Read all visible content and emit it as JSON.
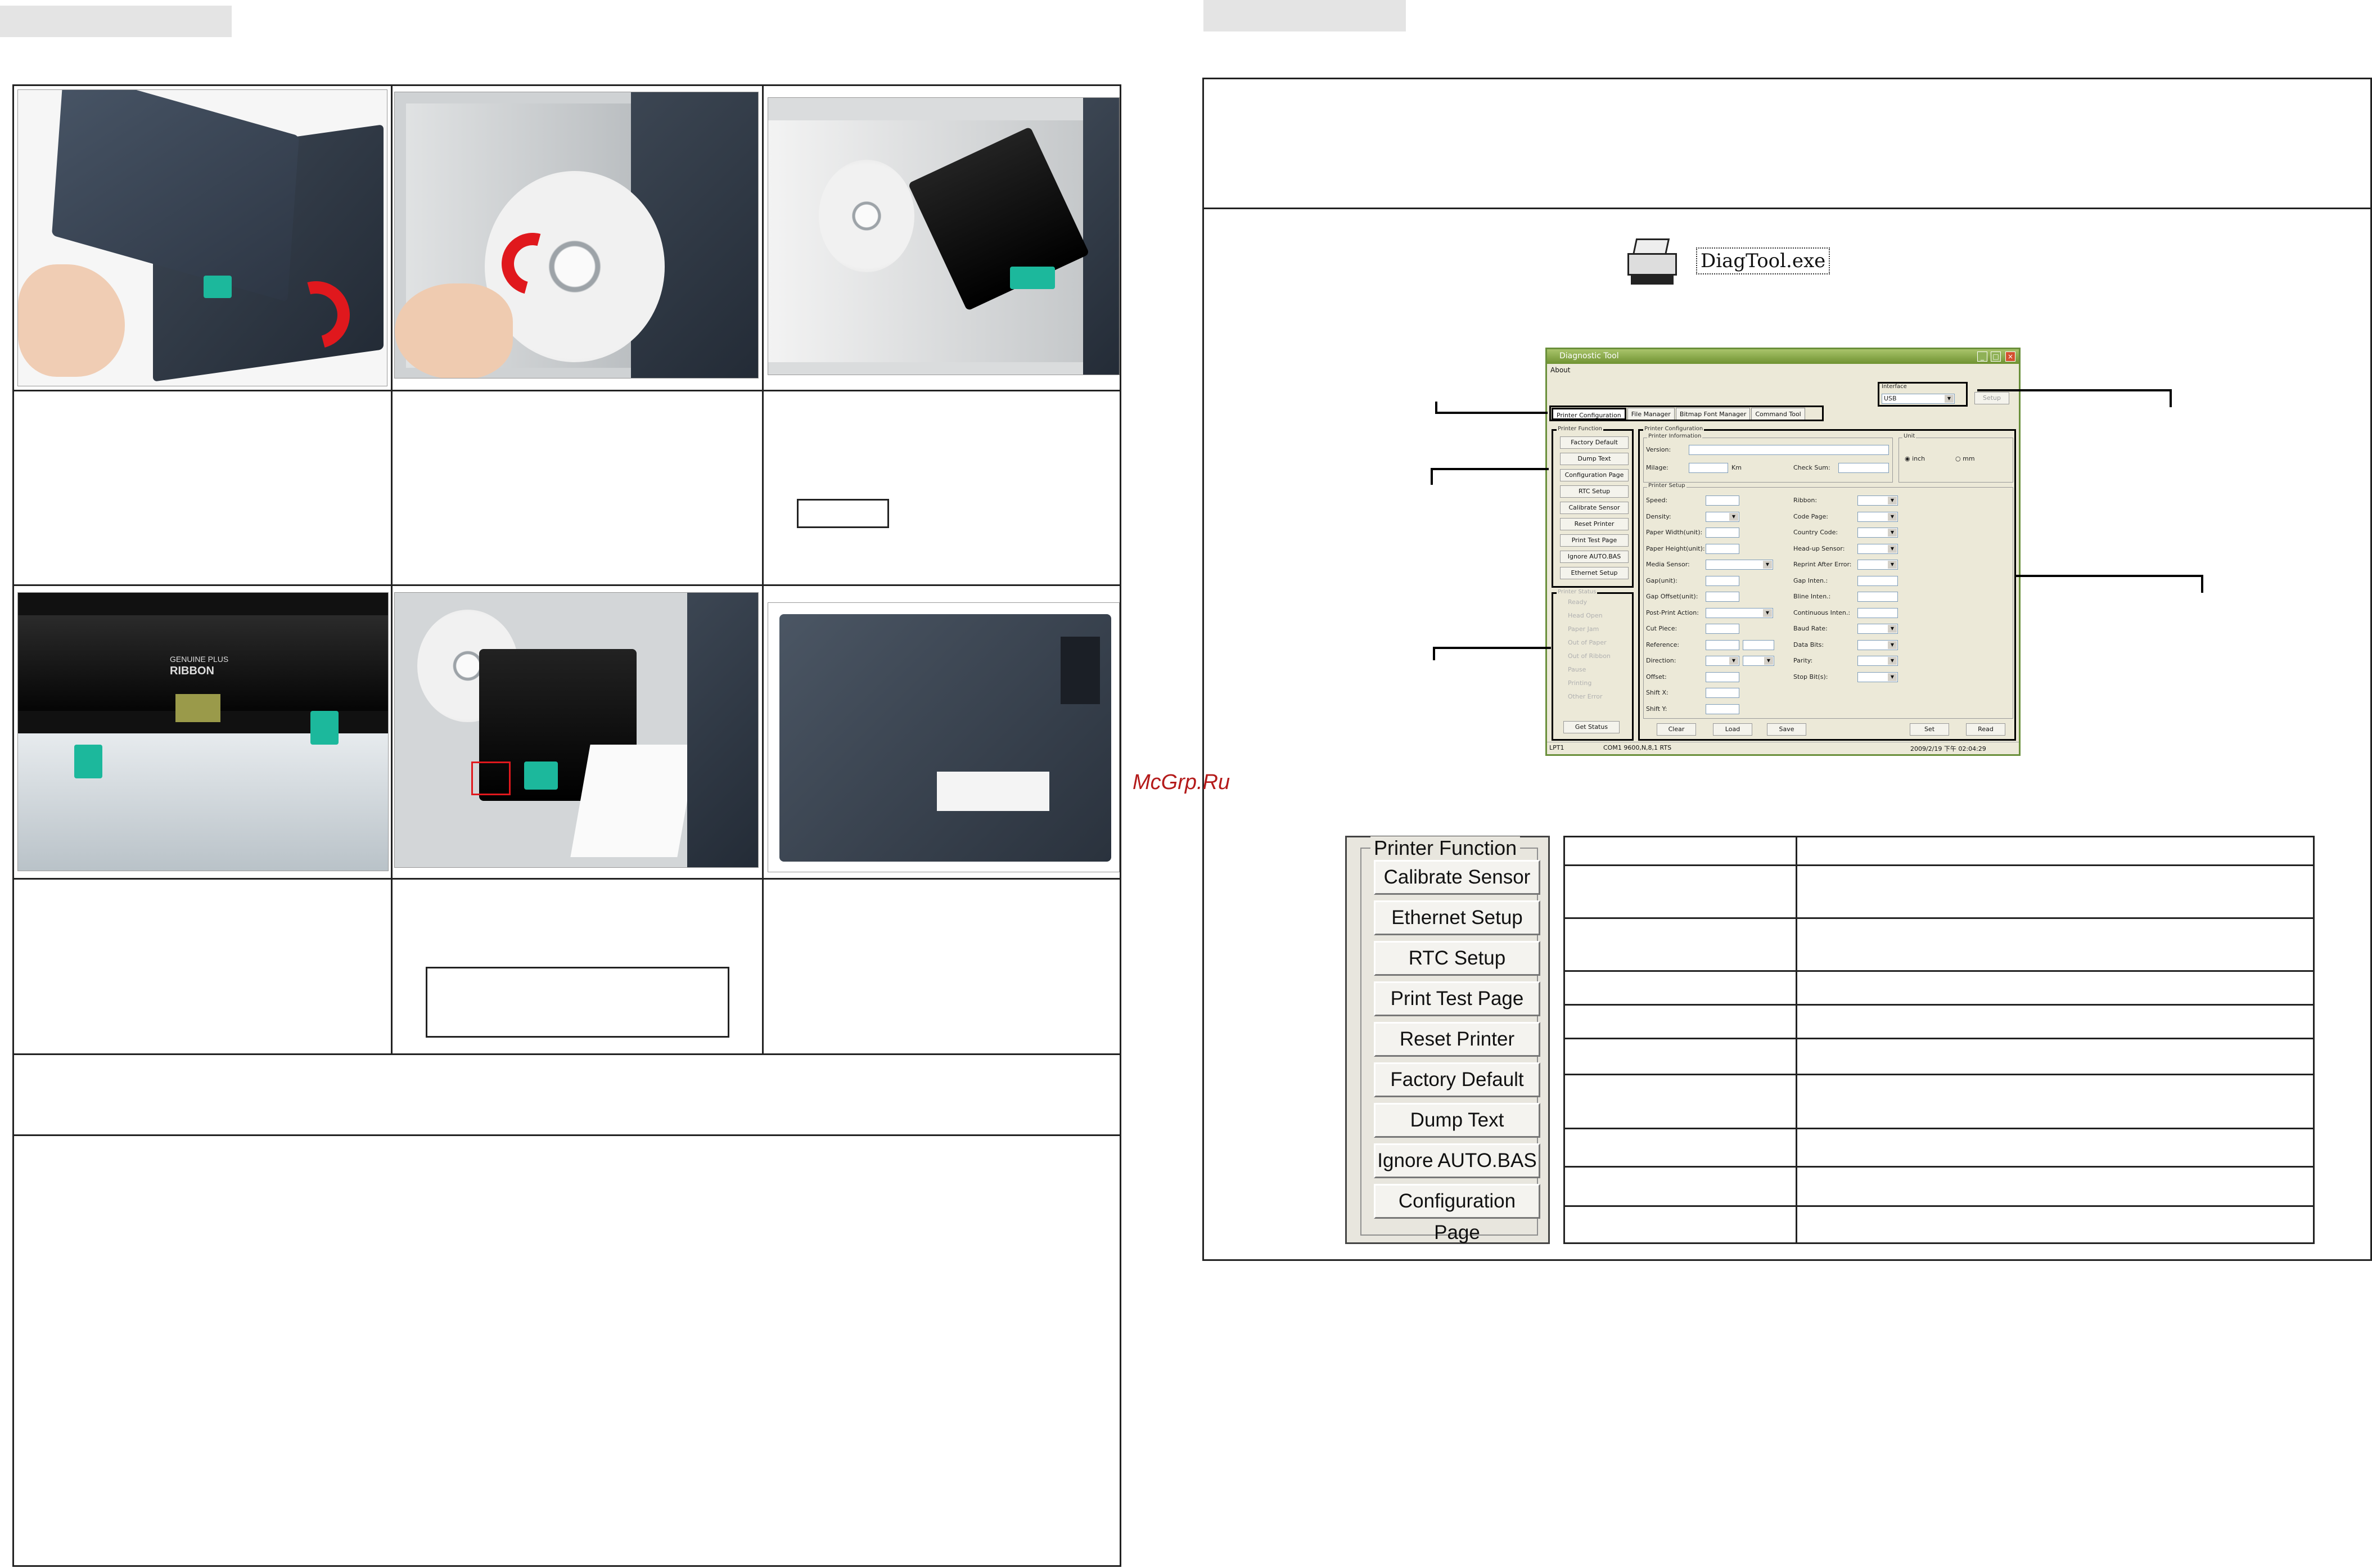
{
  "header_tabs": {
    "left": "",
    "right": ""
  },
  "watermark": "McGrp.Ru",
  "desktop_icon": {
    "icon": "printer-icon",
    "label": "DiagTool.exe"
  },
  "diag_tool": {
    "title": "Diagnostic Tool",
    "menu": {
      "about": "About"
    },
    "tabs": [
      "Printer Configuration",
      "File Manager",
      "Bitmap Font Manager",
      "Command Tool"
    ],
    "interface": {
      "label": "Interface",
      "value": "USB",
      "setup": "Setup"
    },
    "printer_function": {
      "title": "Printer Function",
      "buttons": [
        "Factory Default",
        "Dump Text",
        "Configuration Page",
        "RTC Setup",
        "Calibrate Sensor",
        "Reset Printer",
        "Print Test Page",
        "Ignore AUTO.BAS",
        "Ethernet Setup"
      ]
    },
    "printer_status": {
      "title": "Printer Status",
      "items": [
        "Ready",
        "Head Open",
        "Paper Jam",
        "Out of Paper",
        "Out of Ribbon",
        "Pause",
        "Printing",
        "Other Error"
      ],
      "get_status": "Get Status"
    },
    "printer_configuration": {
      "title": "Printer Configuration",
      "info_title": "Printer Information",
      "version": "Version:",
      "milage": "Milage:",
      "km": "Km",
      "check_sum": "Check Sum:",
      "unit_title": "Unit",
      "unit_inch": "inch",
      "unit_mm": "mm",
      "setup_title": "Printer Setup",
      "left_fields": [
        "Speed:",
        "Density:",
        "Paper Width(unit):",
        "Paper Height(unit):",
        "Media Sensor:",
        "Gap(unit):",
        "Gap Offset(unit):",
        "Post-Print Action:",
        "Cut Piece:",
        "Reference:",
        "Direction:",
        "Offset:",
        "Shift X:",
        "Shift Y:"
      ],
      "right_fields": [
        "Ribbon:",
        "Code Page:",
        "Country Code:",
        "Head-up Sensor:",
        "Reprint After Error:",
        "Gap Inten.:",
        "Bline Inten.:",
        "Continuous Inten.:",
        "Baud Rate:",
        "Data Bits:",
        "Parity:",
        "Stop Bit(s):"
      ],
      "buttons": [
        "Clear",
        "Load",
        "Save",
        "Set",
        "Read"
      ]
    },
    "status_bar": {
      "port": "LPT1",
      "com": "COM1 9600,N,8,1 RTS",
      "datetime": "2009/2/19 下午 02:04:29"
    }
  },
  "printer_function_panel": {
    "title": "Printer Function",
    "buttons": [
      "Calibrate Sensor",
      "Ethernet Setup",
      "RTC Setup",
      "Print Test Page",
      "Reset Printer",
      "Factory Default",
      "Dump Text",
      "Ignore AUTO.BAS",
      "Configuration Page"
    ]
  },
  "photos": {
    "ribbon_label": "RIBBON",
    "ribbon_brand": "GENUINE PLUS"
  }
}
